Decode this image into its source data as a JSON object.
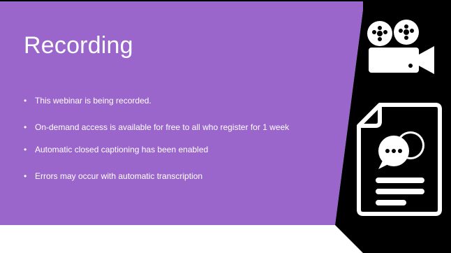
{
  "slide": {
    "title": "Recording",
    "bullets": [
      "This webinar is being recorded.",
      "On-demand access is available for free to all who register for 1 week",
      " Automatic closed captioning has been enabled",
      "Errors may occur with automatic transcription"
    ],
    "icons": [
      "video-camera-icon",
      "document-chat-icon"
    ],
    "colors": {
      "purple": "#9b66cc",
      "black": "#000000",
      "text": "#ffffff"
    }
  }
}
